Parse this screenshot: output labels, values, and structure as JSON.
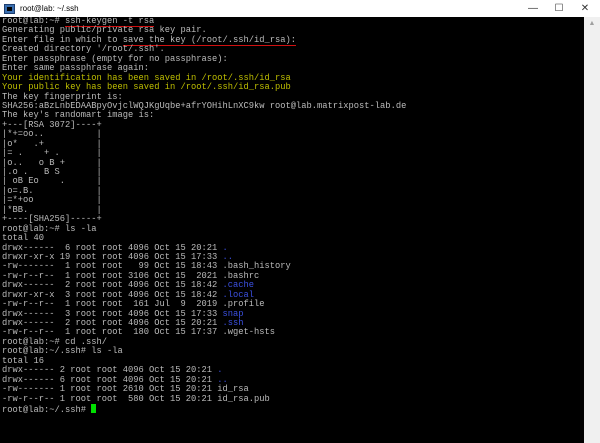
{
  "window": {
    "title": "root@lab: ~/.ssh",
    "minimize": "—",
    "maximize": "☐",
    "close": "✕"
  },
  "terminal": {
    "lines": [
      [
        [
          "root@lab:~# ",
          ""
        ],
        [
          "ssh-keygen -t rsa",
          "ul"
        ]
      ],
      [
        [
          "Generating public/private rsa key pair.",
          ""
        ]
      ],
      [
        [
          "Enter file in which to ",
          ""
        ],
        [
          "save the key (/root/.ssh/id_rsa):",
          "ul"
        ]
      ],
      [
        [
          "Created directory '/root/.ssh'.",
          ""
        ]
      ],
      [
        [
          "Enter passphrase (empty for no passphrase):",
          ""
        ]
      ],
      [
        [
          "Enter same passphrase again:",
          ""
        ]
      ],
      [
        [
          "Your identification has been saved in /root/.ssh/id_rsa",
          "y"
        ]
      ],
      [
        [
          "Your public key has been saved in /root/.ssh/id_rsa.pub",
          "y"
        ]
      ],
      [
        [
          "The key fingerprint is:",
          ""
        ]
      ],
      [
        [
          "SHA256:aBzLnbEDAABpyOvjclWQJKgUqbe+afrYOHihLnXC9kw root@lab.matrixpost-lab.de",
          ""
        ]
      ],
      [
        [
          "The key's randomart image is:",
          ""
        ]
      ],
      [
        [
          "+---[RSA 3072]----+",
          ""
        ]
      ],
      [
        [
          "|*+=oo..          |",
          ""
        ]
      ],
      [
        [
          "|o*   .+          |",
          ""
        ]
      ],
      [
        [
          "|= .    + .       |",
          ""
        ]
      ],
      [
        [
          "|o..   o B +      |",
          ""
        ]
      ],
      [
        [
          "|.o .   B S       |",
          ""
        ]
      ],
      [
        [
          "| oB Eo    .      |",
          ""
        ]
      ],
      [
        [
          "|o=.B.            |",
          ""
        ]
      ],
      [
        [
          "|=*+oo            |",
          ""
        ]
      ],
      [
        [
          "|*BB.             |",
          ""
        ]
      ],
      [
        [
          "+----[SHA256]-----+",
          ""
        ]
      ],
      [
        [
          "root@lab:~# ls -la",
          ""
        ]
      ],
      [
        [
          "total 40",
          ""
        ]
      ],
      [
        [
          "drwx------  6 root root 4096 Oct 15 20:21 ",
          ""
        ],
        [
          ".",
          "b"
        ]
      ],
      [
        [
          "drwxr-xr-x 19 root root 4096 Oct 15 17:33 ",
          ""
        ],
        [
          "..",
          "b"
        ]
      ],
      [
        [
          "-rw-------  1 root root   99 Oct 15 18:43 .bash_history",
          ""
        ]
      ],
      [
        [
          "-rw-r--r--  1 root root 3106 Oct 15  2021 .bashrc",
          ""
        ]
      ],
      [
        [
          "drwx------  2 root root 4096 Oct 15 18:42 ",
          ""
        ],
        [
          ".cache",
          "b"
        ]
      ],
      [
        [
          "drwxr-xr-x  3 root root 4096 Oct 15 18:42 ",
          ""
        ],
        [
          ".local",
          "b"
        ]
      ],
      [
        [
          "-rw-r--r--  1 root root  161 Jul  9  2019 .profile",
          ""
        ]
      ],
      [
        [
          "drwx------  3 root root 4096 Oct 15 17:33 ",
          ""
        ],
        [
          "snap",
          "b"
        ]
      ],
      [
        [
          "drwx------  2 root root 4096 Oct 15 20:21 ",
          ""
        ],
        [
          ".ssh",
          "b"
        ]
      ],
      [
        [
          "-rw-r--r--  1 root root  180 Oct 15 17:37 .wget-hsts",
          ""
        ]
      ],
      [
        [
          "root@lab:~# cd .ssh/",
          ""
        ]
      ],
      [
        [
          "root@lab:~/.ssh# ls -la",
          ""
        ]
      ],
      [
        [
          "total 16",
          ""
        ]
      ],
      [
        [
          "drwx------ 2 root root 4096 Oct 15 20:21 ",
          ""
        ],
        [
          ".",
          "b"
        ]
      ],
      [
        [
          "drwx------ 6 root root 4096 Oct 15 20:21 ",
          ""
        ],
        [
          "..",
          "b"
        ]
      ],
      [
        [
          "-rw------- 1 root root 2610 Oct 15 20:21 id_rsa",
          ""
        ]
      ],
      [
        [
          "-rw-r--r-- 1 root root  580 Oct 15 20:21 id_rsa.pub",
          ""
        ]
      ],
      [
        [
          "root@lab:~/.ssh# ",
          ""
        ]
      ]
    ]
  },
  "colors": {
    "background": "#000000",
    "text": "#bbbbbb",
    "yellow": "#bfbf00",
    "directory": "#3b50e0",
    "cursor": "#00e000",
    "annotation": "#d01010"
  }
}
